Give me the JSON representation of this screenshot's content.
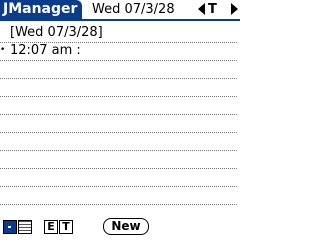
{
  "header": {
    "app_name": "JManager",
    "date_title": "Wed 07/3/28",
    "nav_center": "T"
  },
  "memo": {
    "lines": [
      {
        "text": "[Wed 07/3/28]",
        "bullet": ""
      },
      {
        "text": "12:07 am :",
        "bullet": "•"
      },
      {
        "text": "",
        "bullet": ""
      },
      {
        "text": "",
        "bullet": ""
      },
      {
        "text": "",
        "bullet": ""
      },
      {
        "text": "",
        "bullet": ""
      },
      {
        "text": "",
        "bullet": ""
      },
      {
        "text": "",
        "bullet": ""
      },
      {
        "text": "",
        "bullet": ""
      },
      {
        "text": "",
        "bullet": ""
      }
    ]
  },
  "footer": {
    "e_label": "E",
    "t_label": "T",
    "new_label": "New"
  },
  "colors": {
    "accent": "#0a3b8f"
  },
  "icons": {
    "prev": "left-triangle-icon",
    "next": "right-triangle-icon"
  }
}
